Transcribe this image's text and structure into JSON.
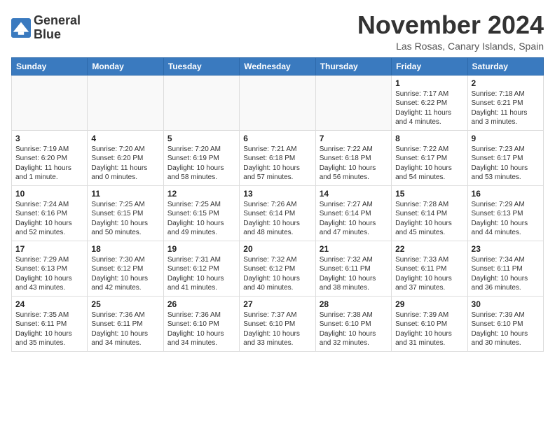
{
  "header": {
    "logo_line1": "General",
    "logo_line2": "Blue",
    "month": "November 2024",
    "location": "Las Rosas, Canary Islands, Spain"
  },
  "days_of_week": [
    "Sunday",
    "Monday",
    "Tuesday",
    "Wednesday",
    "Thursday",
    "Friday",
    "Saturday"
  ],
  "weeks": [
    [
      {
        "day": "",
        "info": ""
      },
      {
        "day": "",
        "info": ""
      },
      {
        "day": "",
        "info": ""
      },
      {
        "day": "",
        "info": ""
      },
      {
        "day": "",
        "info": ""
      },
      {
        "day": "1",
        "info": "Sunrise: 7:17 AM\nSunset: 6:22 PM\nDaylight: 11 hours and 4 minutes."
      },
      {
        "day": "2",
        "info": "Sunrise: 7:18 AM\nSunset: 6:21 PM\nDaylight: 11 hours and 3 minutes."
      }
    ],
    [
      {
        "day": "3",
        "info": "Sunrise: 7:19 AM\nSunset: 6:20 PM\nDaylight: 11 hours and 1 minute."
      },
      {
        "day": "4",
        "info": "Sunrise: 7:20 AM\nSunset: 6:20 PM\nDaylight: 11 hours and 0 minutes."
      },
      {
        "day": "5",
        "info": "Sunrise: 7:20 AM\nSunset: 6:19 PM\nDaylight: 10 hours and 58 minutes."
      },
      {
        "day": "6",
        "info": "Sunrise: 7:21 AM\nSunset: 6:18 PM\nDaylight: 10 hours and 57 minutes."
      },
      {
        "day": "7",
        "info": "Sunrise: 7:22 AM\nSunset: 6:18 PM\nDaylight: 10 hours and 56 minutes."
      },
      {
        "day": "8",
        "info": "Sunrise: 7:22 AM\nSunset: 6:17 PM\nDaylight: 10 hours and 54 minutes."
      },
      {
        "day": "9",
        "info": "Sunrise: 7:23 AM\nSunset: 6:17 PM\nDaylight: 10 hours and 53 minutes."
      }
    ],
    [
      {
        "day": "10",
        "info": "Sunrise: 7:24 AM\nSunset: 6:16 PM\nDaylight: 10 hours and 52 minutes."
      },
      {
        "day": "11",
        "info": "Sunrise: 7:25 AM\nSunset: 6:15 PM\nDaylight: 10 hours and 50 minutes."
      },
      {
        "day": "12",
        "info": "Sunrise: 7:25 AM\nSunset: 6:15 PM\nDaylight: 10 hours and 49 minutes."
      },
      {
        "day": "13",
        "info": "Sunrise: 7:26 AM\nSunset: 6:14 PM\nDaylight: 10 hours and 48 minutes."
      },
      {
        "day": "14",
        "info": "Sunrise: 7:27 AM\nSunset: 6:14 PM\nDaylight: 10 hours and 47 minutes."
      },
      {
        "day": "15",
        "info": "Sunrise: 7:28 AM\nSunset: 6:14 PM\nDaylight: 10 hours and 45 minutes."
      },
      {
        "day": "16",
        "info": "Sunrise: 7:29 AM\nSunset: 6:13 PM\nDaylight: 10 hours and 44 minutes."
      }
    ],
    [
      {
        "day": "17",
        "info": "Sunrise: 7:29 AM\nSunset: 6:13 PM\nDaylight: 10 hours and 43 minutes."
      },
      {
        "day": "18",
        "info": "Sunrise: 7:30 AM\nSunset: 6:12 PM\nDaylight: 10 hours and 42 minutes."
      },
      {
        "day": "19",
        "info": "Sunrise: 7:31 AM\nSunset: 6:12 PM\nDaylight: 10 hours and 41 minutes."
      },
      {
        "day": "20",
        "info": "Sunrise: 7:32 AM\nSunset: 6:12 PM\nDaylight: 10 hours and 40 minutes."
      },
      {
        "day": "21",
        "info": "Sunrise: 7:32 AM\nSunset: 6:11 PM\nDaylight: 10 hours and 38 minutes."
      },
      {
        "day": "22",
        "info": "Sunrise: 7:33 AM\nSunset: 6:11 PM\nDaylight: 10 hours and 37 minutes."
      },
      {
        "day": "23",
        "info": "Sunrise: 7:34 AM\nSunset: 6:11 PM\nDaylight: 10 hours and 36 minutes."
      }
    ],
    [
      {
        "day": "24",
        "info": "Sunrise: 7:35 AM\nSunset: 6:11 PM\nDaylight: 10 hours and 35 minutes."
      },
      {
        "day": "25",
        "info": "Sunrise: 7:36 AM\nSunset: 6:11 PM\nDaylight: 10 hours and 34 minutes."
      },
      {
        "day": "26",
        "info": "Sunrise: 7:36 AM\nSunset: 6:10 PM\nDaylight: 10 hours and 34 minutes."
      },
      {
        "day": "27",
        "info": "Sunrise: 7:37 AM\nSunset: 6:10 PM\nDaylight: 10 hours and 33 minutes."
      },
      {
        "day": "28",
        "info": "Sunrise: 7:38 AM\nSunset: 6:10 PM\nDaylight: 10 hours and 32 minutes."
      },
      {
        "day": "29",
        "info": "Sunrise: 7:39 AM\nSunset: 6:10 PM\nDaylight: 10 hours and 31 minutes."
      },
      {
        "day": "30",
        "info": "Sunrise: 7:39 AM\nSunset: 6:10 PM\nDaylight: 10 hours and 30 minutes."
      }
    ]
  ]
}
